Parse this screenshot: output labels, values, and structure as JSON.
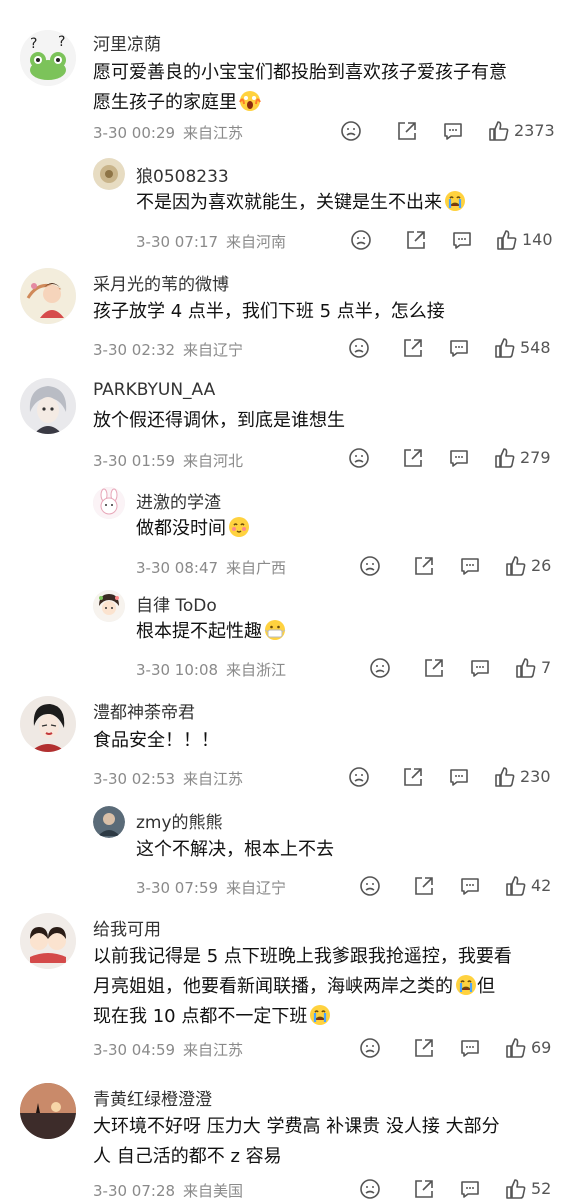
{
  "comments": [
    {
      "user": "河里凉荫",
      "lines": [
        "愿可爱善良的小宝宝们都投胎到喜欢孩子爱孩子有意",
        "愿生孩子的家庭里"
      ],
      "emoji": "scream-emoji",
      "date": "3-30 00:29",
      "location": "来自江苏",
      "likes": "2373",
      "avatar_icon": "frog-avatar-icon",
      "replies": [
        {
          "user": "狼0508233",
          "lines": [
            "不是因为喜欢就能生，关键是生不出来"
          ],
          "emoji": "crying-emoji",
          "date": "3-30 07:17",
          "location": "来自河南",
          "likes": "140",
          "avatar_icon": "flower-avatar-icon"
        }
      ]
    },
    {
      "user": "采月光的苇的微博",
      "lines": [
        "孩子放学 4 点半，我们下班 5 点半，怎么接"
      ],
      "date": "3-30 02:32",
      "location": "来自辽宁",
      "likes": "548",
      "avatar_icon": "illustration-avatar-icon",
      "replies": []
    },
    {
      "user": "PARKBYUN_AA",
      "lines": [
        "放个假还得调休，到底是谁想生"
      ],
      "date": "3-30 01:59",
      "location": "来自河北",
      "likes": "279",
      "avatar_icon": "anime-avatar-icon",
      "replies": [
        {
          "user": "进激的学渣",
          "lines": [
            "做都没时间"
          ],
          "emoji": "blush-emoji",
          "date": "3-30 08:47",
          "location": "来自广西",
          "likes": "26",
          "avatar_icon": "bunny-avatar-icon"
        },
        {
          "user": "自律 ToDo",
          "lines": [
            "根本提不起性趣"
          ],
          "emoji": "mask-emoji",
          "date": "3-30 10:08",
          "location": "来自浙江",
          "likes": "7",
          "avatar_icon": "cartoon-avatar-icon"
        }
      ]
    },
    {
      "user": "澧都神荼帝君",
      "lines": [
        "食品安全！！！"
      ],
      "date": "3-30 02:53",
      "location": "来自江苏",
      "likes": "230",
      "avatar_icon": "portrait-avatar-icon",
      "replies": [
        {
          "user": "zmy的熊熊",
          "lines": [
            "这个不解决，根本上不去"
          ],
          "date": "3-30 07:59",
          "location": "来自辽宁",
          "likes": "42",
          "avatar_icon": "photo-avatar-icon"
        }
      ]
    },
    {
      "user": "给我可用",
      "lines": [
        "以前我记得是 5 点下班晚上我爹跟我抢遥控，我要看",
        "月亮姐姐，他要看新闻联播，海峡两岸之类的",
        "现在我 10 点都不一定下班"
      ],
      "line_emojis": [
        "",
        "crying-emoji",
        "crying-emoji"
      ],
      "line_tail": [
        "",
        "但",
        ""
      ],
      "date": "3-30 04:59",
      "location": "来自江苏",
      "likes": "69",
      "avatar_icon": "couple-avatar-icon",
      "replies": []
    },
    {
      "user": "青黄红绿橙澄澄",
      "lines": [
        "大环境不好呀 压力大 学费高 补课贵 没人接 大部分",
        "人 自己活的都不 z 容易"
      ],
      "date": "3-30 07:28",
      "location": "来自美国",
      "likes": "52",
      "avatar_icon": "sunset-avatar-icon",
      "replies": []
    }
  ],
  "icons": {
    "dislike": "frown-face-icon",
    "share": "share-icon",
    "comment": "comment-icon",
    "like": "thumbs-up-icon"
  },
  "colors": {
    "text": "#111111",
    "meta": "#8a8a8a",
    "name": "#333333"
  }
}
